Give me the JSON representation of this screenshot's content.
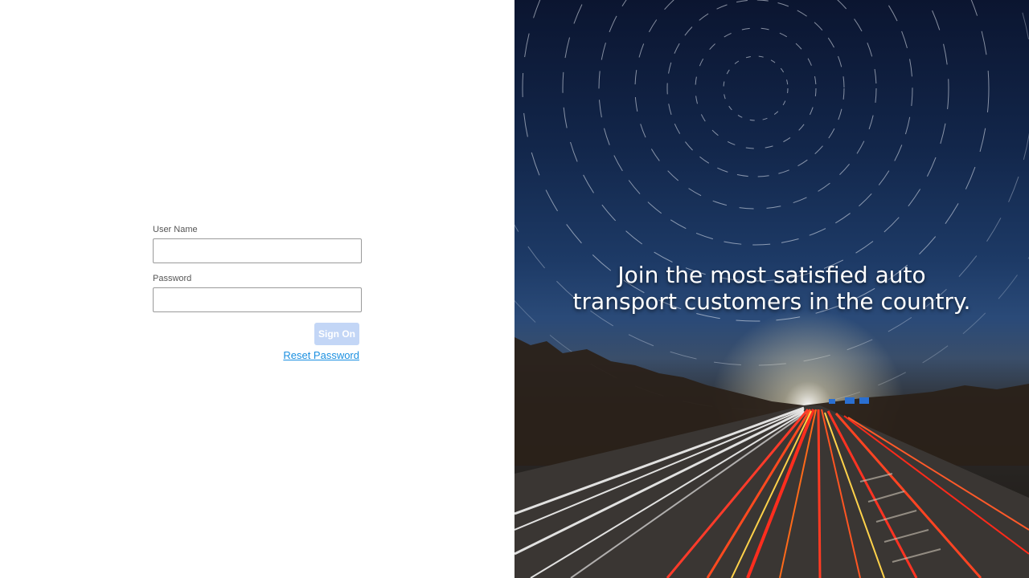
{
  "login": {
    "username_label": "User Name",
    "username_value": "",
    "password_label": "Password",
    "password_value": "",
    "signon_label": "Sign On",
    "reset_label": "Reset Password"
  },
  "hero": {
    "tagline_line1": "Join the most satisfied auto",
    "tagline_line2": "transport customers in the country."
  },
  "colors": {
    "signon_button": "#c3d6f6",
    "link": "#1a8fe0"
  }
}
